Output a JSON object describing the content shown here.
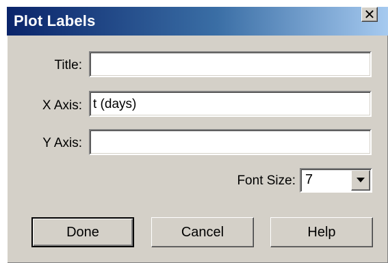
{
  "window": {
    "title": "Plot Labels",
    "close_icon": "close-icon"
  },
  "form": {
    "title": {
      "label": "Title:",
      "value": ""
    },
    "x_axis": {
      "label": "X Axis:",
      "value": "t (days)"
    },
    "y_axis": {
      "label": "Y Axis:",
      "value": ""
    },
    "font_size": {
      "label": "Font Size:",
      "value": "7",
      "dropdown_icon": "chevron-down-icon"
    }
  },
  "buttons": {
    "done": "Done",
    "cancel": "Cancel",
    "help": "Help"
  },
  "colors": {
    "titlebar_start": "#0a246a",
    "titlebar_end": "#a6caf0",
    "dialog_face": "#d4d0c8"
  }
}
